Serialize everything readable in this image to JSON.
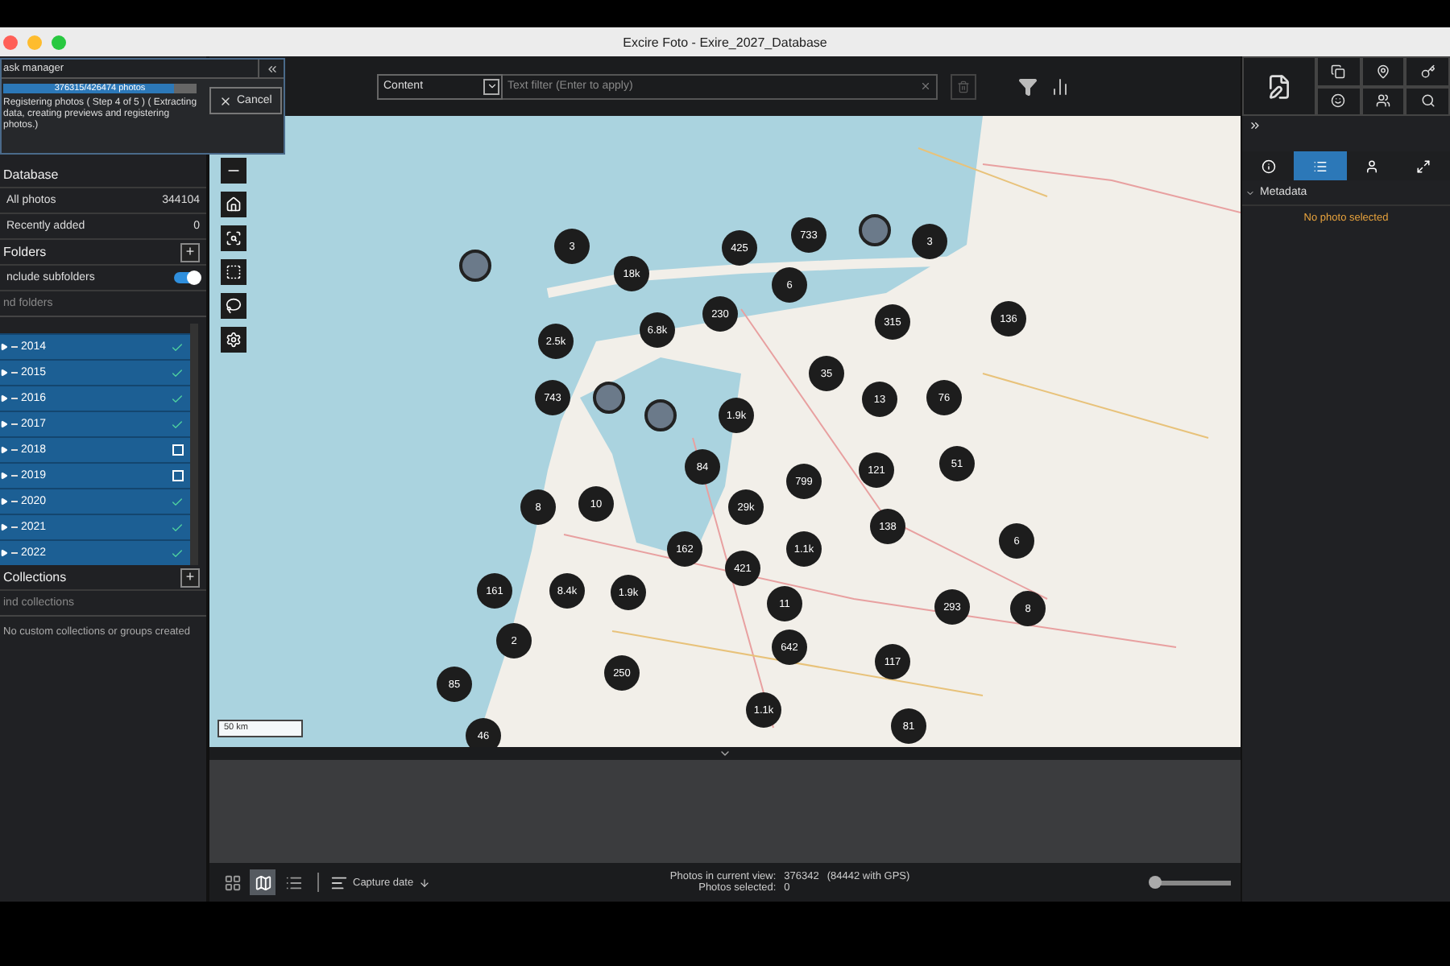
{
  "window": {
    "title": "Excire Foto - Exire_2027_Database"
  },
  "task_manager": {
    "title": "ask manager",
    "progress": {
      "label": "376315/426474 photos",
      "level": 0.88
    },
    "message": "Registering photos ( Step 4 of 5 ) ( Extracting data, creating previews and registering photos.)",
    "cancel": "Cancel"
  },
  "sidebar": {
    "database": {
      "title": "Database",
      "rows": [
        {
          "label": "All photos",
          "count": "344104"
        },
        {
          "label": "Recently added",
          "count": "0"
        }
      ]
    },
    "folders": {
      "title": "Folders",
      "add": "+",
      "include_subfolders": {
        "label": "nclude subfolders",
        "on": true
      },
      "search": {
        "placeholder": "nd folders"
      },
      "items": [
        {
          "name": "2014",
          "checked": true,
          "selected": true
        },
        {
          "name": "2015",
          "checked": true,
          "selected": true
        },
        {
          "name": "2016",
          "checked": true,
          "selected": true
        },
        {
          "name": "2017",
          "checked": true,
          "selected": true
        },
        {
          "name": "2018",
          "checked": false,
          "selected": true
        },
        {
          "name": "2019",
          "checked": false,
          "selected": true
        },
        {
          "name": "2020",
          "checked": true,
          "selected": true
        },
        {
          "name": "2021",
          "checked": true,
          "selected": true
        },
        {
          "name": "2022",
          "checked": true,
          "selected": true
        }
      ]
    },
    "collections": {
      "title": "Collections",
      "add": "+",
      "search": {
        "placeholder": "ind collections"
      },
      "empty": "No custom collections or groups created"
    }
  },
  "toolbar": {
    "filter_type": "Content",
    "search": {
      "placeholder": "Text filter (Enter to apply)"
    }
  },
  "map": {
    "scale": "50 km",
    "clusters": [
      {
        "kind": "photo"
      },
      {
        "kind": "count",
        "label": "3"
      },
      {
        "kind": "count",
        "label": "18k"
      },
      {
        "kind": "count",
        "label": "425"
      },
      {
        "kind": "count",
        "label": "733"
      },
      {
        "kind": "photo"
      },
      {
        "kind": "count",
        "label": "3"
      },
      {
        "kind": "count",
        "label": "6"
      },
      {
        "kind": "count",
        "label": "230"
      },
      {
        "kind": "count",
        "label": "6.8k"
      },
      {
        "kind": "count",
        "label": "2.5k"
      },
      {
        "kind": "count",
        "label": "315"
      },
      {
        "kind": "count",
        "label": "136"
      },
      {
        "kind": "count",
        "label": "35"
      },
      {
        "kind": "count",
        "label": "743"
      },
      {
        "kind": "photo"
      },
      {
        "kind": "photo"
      },
      {
        "kind": "count",
        "label": "1.9k"
      },
      {
        "kind": "count",
        "label": "13"
      },
      {
        "kind": "count",
        "label": "76"
      },
      {
        "kind": "count",
        "label": "84"
      },
      {
        "kind": "count",
        "label": "799"
      },
      {
        "kind": "count",
        "label": "121"
      },
      {
        "kind": "count",
        "label": "51"
      },
      {
        "kind": "count",
        "label": "8"
      },
      {
        "kind": "count",
        "label": "10"
      },
      {
        "kind": "count",
        "label": "29k"
      },
      {
        "kind": "count",
        "label": "138"
      },
      {
        "kind": "count",
        "label": "6"
      },
      {
        "kind": "count",
        "label": "162"
      },
      {
        "kind": "count",
        "label": "1.1k"
      },
      {
        "kind": "count",
        "label": "421"
      },
      {
        "kind": "count",
        "label": "161"
      },
      {
        "kind": "count",
        "label": "8.4k"
      },
      {
        "kind": "count",
        "label": "1.9k"
      },
      {
        "kind": "count",
        "label": "11"
      },
      {
        "kind": "count",
        "label": "293"
      },
      {
        "kind": "count",
        "label": "8"
      },
      {
        "kind": "count",
        "label": "2"
      },
      {
        "kind": "count",
        "label": "642"
      },
      {
        "kind": "count",
        "label": "85"
      },
      {
        "kind": "count",
        "label": "250"
      },
      {
        "kind": "count",
        "label": "117"
      },
      {
        "kind": "count",
        "label": "1.1k"
      },
      {
        "kind": "count",
        "label": "46"
      },
      {
        "kind": "count",
        "label": "81"
      }
    ]
  },
  "right_panel": {
    "tabs": [
      {
        "selected": false
      },
      {
        "selected": true
      },
      {
        "selected": false
      },
      {
        "selected": false
      }
    ],
    "section": "Metadata",
    "empty": "No photo selected"
  },
  "status_bar": {
    "views": [
      {
        "selected": false
      },
      {
        "selected": true
      },
      {
        "selected": false
      }
    ],
    "sort": "Capture date",
    "photos_in_view_label": "Photos in current view:",
    "photos_in_view": "376342",
    "gps": "(84442 with GPS)",
    "photos_selected_label": "Photos selected:",
    "photos_selected": "0",
    "zoom": {
      "level": 0.05
    }
  }
}
